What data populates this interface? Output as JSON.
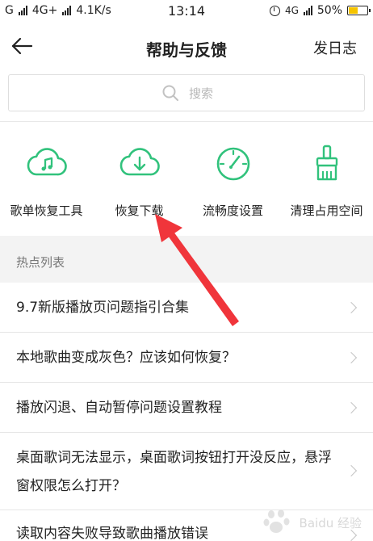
{
  "status_bar": {
    "left_text": "G",
    "network_1": "4G+",
    "speed": "4.1K/s",
    "time": "13:14",
    "network_2": "4G",
    "battery": "50%",
    "battery_level": 0.5
  },
  "nav": {
    "title": "帮助与反馈",
    "action_label": "发日志",
    "back_icon": "back-arrow-icon"
  },
  "search": {
    "placeholder": "搜索",
    "icon": "search-icon"
  },
  "tools": [
    {
      "label": "歌单恢复工具",
      "icon": "cloud-music-icon"
    },
    {
      "label": "恢复下载",
      "icon": "cloud-download-icon"
    },
    {
      "label": "流畅度设置",
      "icon": "speed-gauge-icon"
    },
    {
      "label": "清理占用空间",
      "icon": "brush-icon"
    }
  ],
  "section": {
    "title": "热点列表"
  },
  "hot_list": [
    {
      "text": "9.7新版播放页问题指引合集"
    },
    {
      "text": "本地歌曲变成灰色？应该如何恢复？"
    },
    {
      "text": "播放闪退、自动暂停问题设置教程"
    },
    {
      "text": "桌面歌词无法显示，桌面歌词按钮打开没反应，悬浮窗权限怎么打开？"
    },
    {
      "text": "读取内容失败导致歌曲播放错误"
    }
  ],
  "colors": {
    "accent_green": "#31c27c",
    "annotation_red": "#f0353b"
  },
  "watermark": {
    "text": "Baidu 经验"
  }
}
